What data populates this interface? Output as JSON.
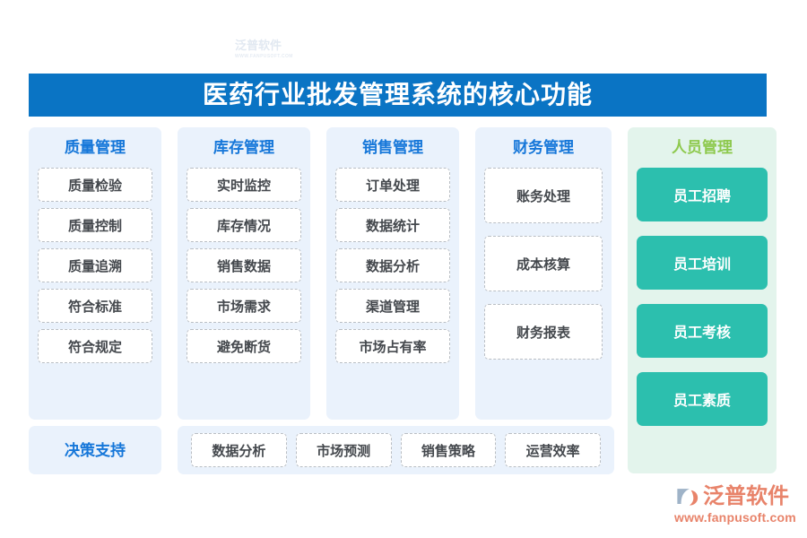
{
  "banner": {
    "title": "医药行业批发管理系统的核心功能",
    "background_color": "#0a74c4",
    "text_color": "#ffffff"
  },
  "theme": {
    "panel_blue": "#eaf2fc",
    "panel_mint": "#e3f4ec",
    "title_blue": "#1677d9",
    "title_green": "#8ec94e",
    "teal_button": "#2cbfae",
    "cell_text": "#44484d",
    "logo_orange": "#e8836a"
  },
  "columns": [
    {
      "title": "质量管理",
      "style": "blue",
      "items": [
        "质量检验",
        "质量控制",
        "质量追溯",
        "符合标准",
        "符合规定"
      ]
    },
    {
      "title": "库存管理",
      "style": "blue",
      "items": [
        "实时监控",
        "库存情况",
        "销售数据",
        "市场需求",
        "避免断货"
      ]
    },
    {
      "title": "销售管理",
      "style": "blue",
      "items": [
        "订单处理",
        "数据统计",
        "数据分析",
        "渠道管理",
        "市场占有率"
      ]
    },
    {
      "title": "财务管理",
      "style": "blue",
      "items": [
        "账务处理",
        "成本核算",
        "财务报表"
      ]
    },
    {
      "title": "人员管理",
      "style": "mint",
      "items": [
        "员工招聘",
        "员工培训",
        "员工考核",
        "员工素质"
      ]
    }
  ],
  "bottom_row": {
    "label": "决策支持",
    "items": [
      "数据分析",
      "市场预测",
      "销售策略",
      "运营效率"
    ]
  },
  "watermarks": [
    {
      "text": "泛普软件",
      "sub": "WWW.FANPUSOFT.COM"
    },
    {
      "text": "泛普软件",
      "sub": "WWW.FANPUSOFT.COM"
    }
  ],
  "logo": {
    "name": "泛普软件",
    "url": "www.fanpusoft.com",
    "mark": "fanpu-logo-icon"
  }
}
